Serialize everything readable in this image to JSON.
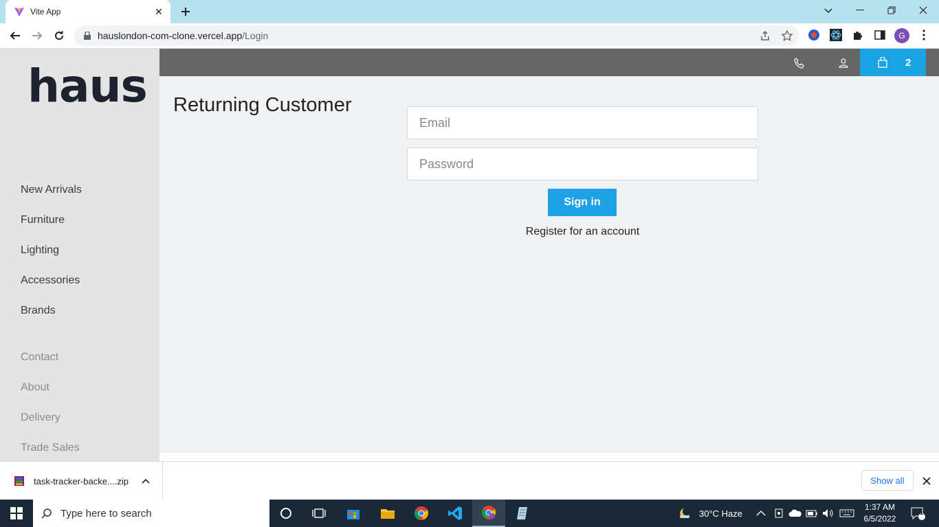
{
  "browser": {
    "tab_title": "Vite App",
    "url_host": "hauslondon-com-clone.vercel.app",
    "url_path": "/Login",
    "profile_initial": "G"
  },
  "site": {
    "logo": "haus",
    "nav_primary": [
      "New Arrivals",
      "Furniture",
      "Lighting",
      "Accessories",
      "Brands"
    ],
    "nav_secondary": [
      "Contact",
      "About",
      "Delivery",
      "Trade Sales"
    ],
    "cart_count": "2",
    "accent_color": "#1aa3e3"
  },
  "login": {
    "heading": "Returning Customer",
    "email_placeholder": "Email",
    "password_placeholder": "Password",
    "signin_label": "Sign in",
    "register_label": "Register for an account"
  },
  "downloads": {
    "file_name": "task-tracker-backe....zip",
    "show_all": "Show all"
  },
  "taskbar": {
    "search_placeholder": "Type here to search",
    "weather": "30°C  Haze",
    "time": "1:37 AM",
    "date": "6/5/2022",
    "notifications": "1"
  }
}
